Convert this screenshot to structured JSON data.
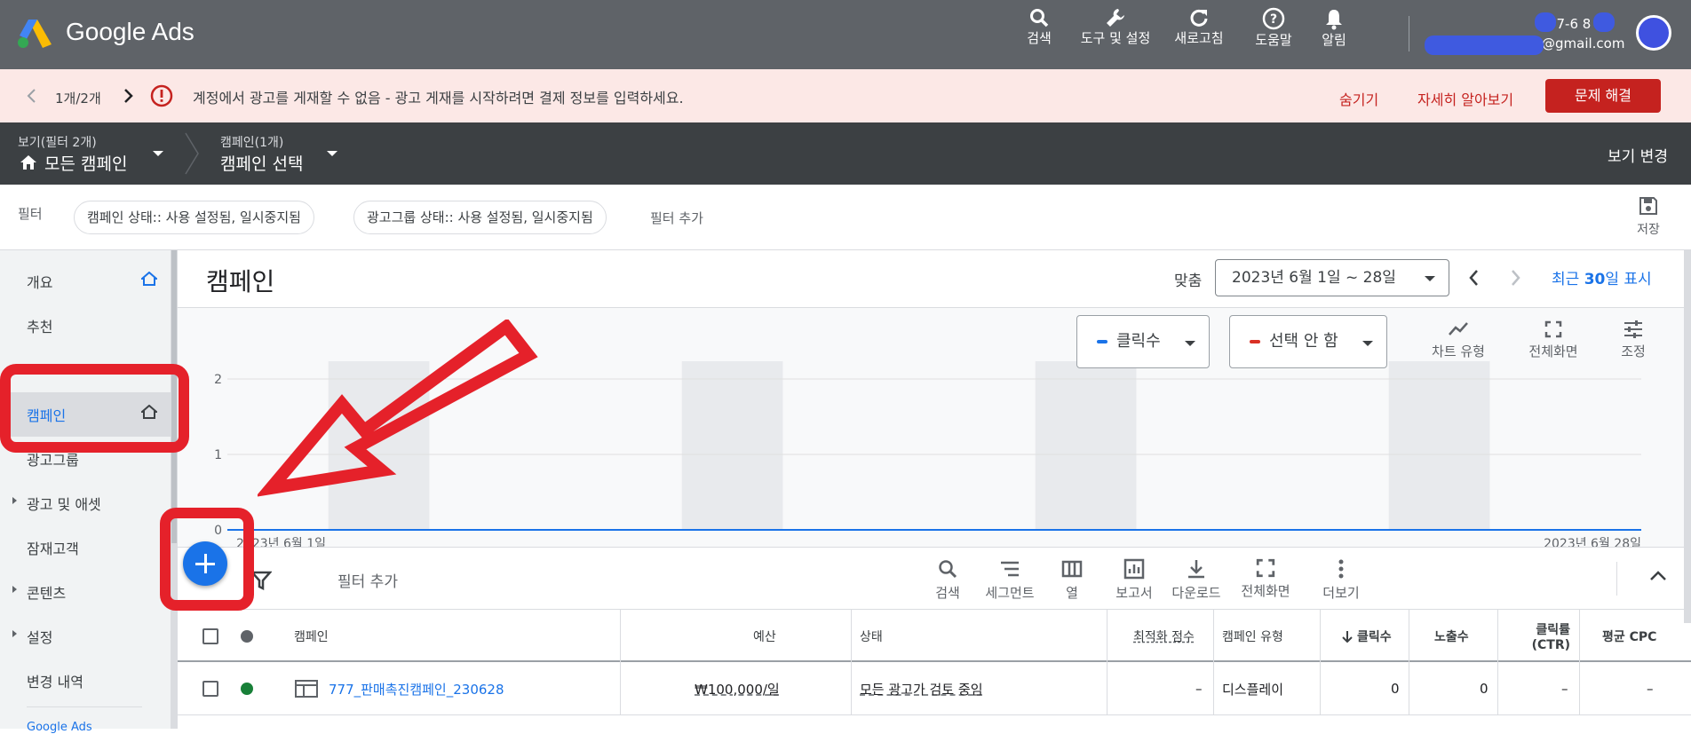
{
  "topbar": {
    "app_name": "Google Ads",
    "buttons": [
      {
        "label": "검색",
        "icon": "search-icon"
      },
      {
        "label": "도구 및 설정",
        "icon": "wrench-icon"
      },
      {
        "label": "새로고침",
        "icon": "refresh-icon"
      },
      {
        "label": "도움말",
        "icon": "help-icon"
      },
      {
        "label": "알림",
        "icon": "bell-icon"
      }
    ],
    "account_phone": "-397-6 8",
    "account_email": "@gmail.com"
  },
  "alert": {
    "pager": "1개/2개",
    "message": "계정에서 광고를 게재할 수 없음 - 광고 게재를 시작하려면 결제 정보를 입력하세요.",
    "hide": "숨기기",
    "learn_more": "자세히 알아보기",
    "fix": "문제 해결"
  },
  "nav": {
    "view_label": "보기(필터 2개)",
    "view_value": "모든 캠페인",
    "campaign_label": "캠페인(1개)",
    "campaign_value": "캠페인 선택",
    "change_view": "보기 변경"
  },
  "filters": {
    "label": "필터",
    "chips": [
      "캠페인 상태:: 사용 설정됨, 일시중지됨",
      "광고그룹 상태:: 사용 설정됨, 일시중지됨"
    ],
    "add": "필터 추가",
    "save": "저장"
  },
  "sidebar": {
    "items": [
      {
        "label": "개요"
      },
      {
        "label": "추천"
      },
      {
        "label": "캠페인"
      },
      {
        "label": "광고그룹"
      },
      {
        "label": "광고 및 애셋"
      },
      {
        "label": "잠재고객"
      },
      {
        "label": "콘텐츠"
      },
      {
        "label": "설정"
      },
      {
        "label": "변경 내역"
      }
    ],
    "footer": "Google Ads"
  },
  "main": {
    "title": "캠페인",
    "date_custom": "맞춤",
    "date_range": "2023년 6월 1일 ~ 28일",
    "recent_prefix": "최근 ",
    "recent_num": "30",
    "recent_suffix": "일 표시"
  },
  "chart": {
    "metric1": "클릭수",
    "metric2": "선택 안 함",
    "tools": [
      {
        "label": "차트 유형",
        "icon": "line-chart-icon"
      },
      {
        "label": "전체화면",
        "icon": "fullscreen-icon"
      },
      {
        "label": "조정",
        "icon": "tune-icon"
      }
    ],
    "start_label": "2023년 6월 1일",
    "end_label": "2023년 6월 28일"
  },
  "chart_data": {
    "type": "line",
    "x": [
      "2023년 6월 1일",
      "2023년 6월 28일"
    ],
    "series": [
      {
        "name": "클릭수",
        "values": [
          0,
          0
        ]
      }
    ],
    "ylim": [
      0,
      2
    ],
    "yticks": [
      0,
      1,
      2
    ],
    "colors": {
      "line": "#1a73e8",
      "weekend": "#e8eaed",
      "metric2": "#d93025"
    }
  },
  "table_toolbar": {
    "filter_add": "필터 추가",
    "buttons": [
      {
        "label": "검색",
        "icon": "search-icon"
      },
      {
        "label": "세그먼트",
        "icon": "segment-icon"
      },
      {
        "label": "열",
        "icon": "columns-icon"
      },
      {
        "label": "보고서",
        "icon": "report-icon"
      },
      {
        "label": "다운로드",
        "icon": "download-icon"
      },
      {
        "label": "전체화면",
        "icon": "fullscreen-icon"
      },
      {
        "label": "더보기",
        "icon": "more-icon"
      }
    ]
  },
  "table": {
    "headers": [
      "캠페인",
      "예산",
      "상태",
      "최적화 점수",
      "캠페인 유형",
      "클릭수",
      "노출수",
      "클릭률",
      "(CTR)",
      "평균 CPC"
    ],
    "rows": [
      {
        "name": "777_판매촉진캠페인_230628",
        "budget": "₩100,000/일",
        "status": "모든 광고가 검토 중임",
        "score": "–",
        "type": "디스플레이",
        "clicks": "0",
        "impressions": "0",
        "ctr": "–",
        "cpc": "–"
      }
    ]
  }
}
